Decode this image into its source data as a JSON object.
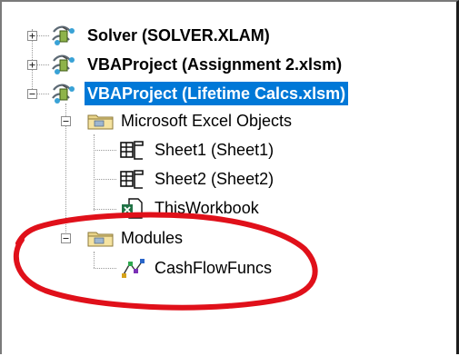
{
  "tree": {
    "projects": [
      {
        "label": "Solver (SOLVER.XLAM)",
        "expanded": false
      },
      {
        "label": "VBAProject (Assignment 2.xlsm)",
        "expanded": false
      },
      {
        "label": "VBAProject (Lifetime Calcs.xlsm)",
        "expanded": true,
        "selected": true
      }
    ],
    "folders": [
      {
        "label": "Microsoft Excel Objects",
        "icon": "folder-icon",
        "expanded": true
      },
      {
        "label": "Modules",
        "icon": "folder-icon",
        "expanded": true
      }
    ],
    "objects": [
      {
        "label": "Sheet1 (Sheet1)",
        "icon": "worksheet-icon"
      },
      {
        "label": "Sheet2 (Sheet2)",
        "icon": "worksheet-icon"
      },
      {
        "label": "ThisWorkbook",
        "icon": "workbook-icon"
      }
    ],
    "modules": [
      {
        "label": "CashFlowFuncs",
        "icon": "module-icon"
      }
    ]
  },
  "colors": {
    "selection": "#0078d7",
    "annotation": "#e0101a"
  }
}
